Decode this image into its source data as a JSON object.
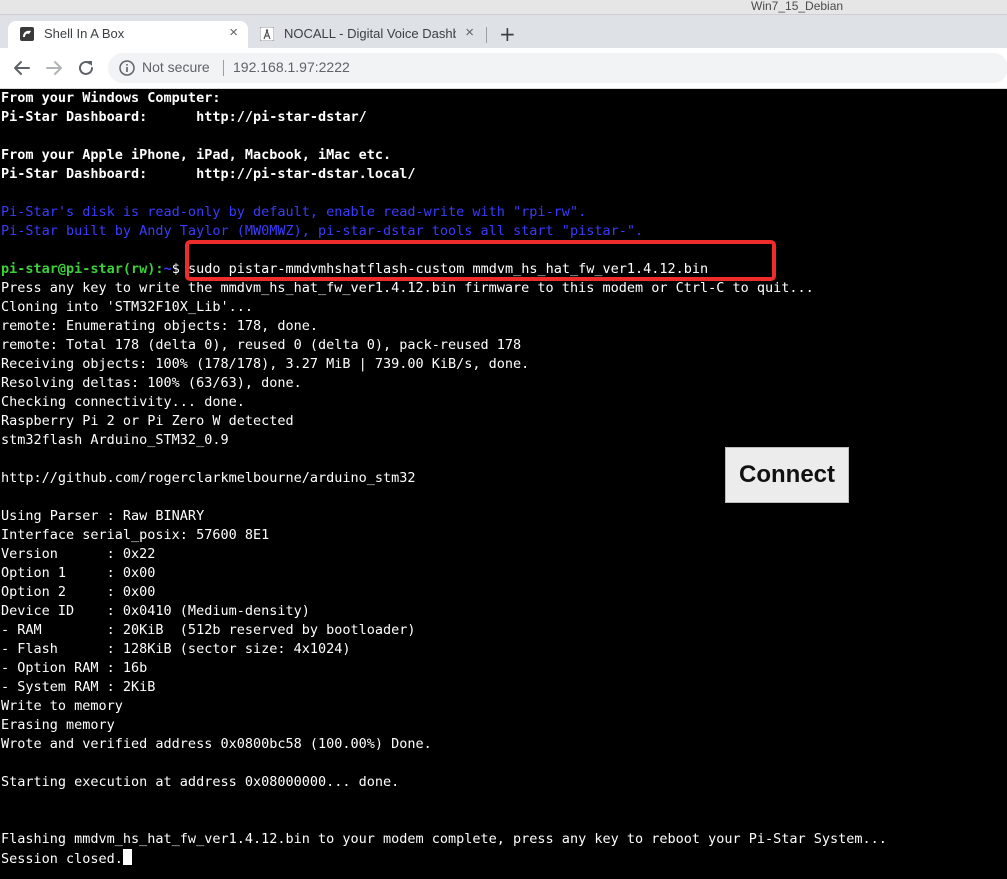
{
  "os": {
    "window_title": "Win7_15_Debian"
  },
  "browser": {
    "tabs": [
      {
        "title": "Shell In A Box",
        "favicon": "shell-icon",
        "active": true
      },
      {
        "title": "NOCALL - Digital Voice Dashb",
        "favicon": "radio-tower-icon",
        "active": false
      }
    ],
    "new_tab_label": "+",
    "close_label": "×",
    "security_label": "Not secure",
    "url": "192.168.1.97:2222"
  },
  "terminal": {
    "lines": [
      {
        "text": "From your Windows Computer:",
        "style": "bold"
      },
      {
        "text": "Pi-Star Dashboard:      http://pi-star-dstar/",
        "style": "bold"
      },
      {
        "text": "",
        "style": ""
      },
      {
        "text": "From your Apple iPhone, iPad, Macbook, iMac etc.",
        "style": "bold"
      },
      {
        "text": "Pi-Star Dashboard:      http://pi-star-dstar.local/",
        "style": "bold"
      },
      {
        "text": "",
        "style": ""
      },
      {
        "text": "Pi-Star's disk is read-only by default, enable read-write with \"rpi-rw\".",
        "style": "blue"
      },
      {
        "text": "Pi-Star built by Andy Taylor (MW0MWZ), pi-star-dstar tools all start \"pistar-\".",
        "style": "blue"
      },
      {
        "text": "",
        "style": ""
      },
      {
        "text": "",
        "style": "prompt"
      },
      {
        "text": "Press any key to write the mmdvm_hs_hat_fw_ver1.4.12.bin firmware to this modem or Ctrl-C to quit...",
        "style": ""
      },
      {
        "text": "Cloning into 'STM32F10X_Lib'...",
        "style": ""
      },
      {
        "text": "remote: Enumerating objects: 178, done.",
        "style": ""
      },
      {
        "text": "remote: Total 178 (delta 0), reused 0 (delta 0), pack-reused 178",
        "style": ""
      },
      {
        "text": "Receiving objects: 100% (178/178), 3.27 MiB | 739.00 KiB/s, done.",
        "style": ""
      },
      {
        "text": "Resolving deltas: 100% (63/63), done.",
        "style": ""
      },
      {
        "text": "Checking connectivity... done.",
        "style": ""
      },
      {
        "text": "Raspberry Pi 2 or Pi Zero W detected",
        "style": ""
      },
      {
        "text": "stm32flash Arduino_STM32_0.9",
        "style": ""
      },
      {
        "text": "",
        "style": ""
      },
      {
        "text": "http://github.com/rogerclarkmelbourne/arduino_stm32",
        "style": ""
      },
      {
        "text": "",
        "style": ""
      },
      {
        "text": "Using Parser : Raw BINARY",
        "style": ""
      },
      {
        "text": "Interface serial_posix: 57600 8E1",
        "style": ""
      },
      {
        "text": "Version      : 0x22",
        "style": ""
      },
      {
        "text": "Option 1     : 0x00",
        "style": ""
      },
      {
        "text": "Option 2     : 0x00",
        "style": ""
      },
      {
        "text": "Device ID    : 0x0410 (Medium-density)",
        "style": ""
      },
      {
        "text": "- RAM        : 20KiB  (512b reserved by bootloader)",
        "style": ""
      },
      {
        "text": "- Flash      : 128KiB (sector size: 4x1024)",
        "style": ""
      },
      {
        "text": "- Option RAM : 16b",
        "style": ""
      },
      {
        "text": "- System RAM : 2KiB",
        "style": ""
      },
      {
        "text": "Write to memory",
        "style": ""
      },
      {
        "text": "Erasing memory",
        "style": ""
      },
      {
        "text": "Wrote and verified address 0x0800bc58 (100.00%) Done.",
        "style": ""
      },
      {
        "text": "",
        "style": ""
      },
      {
        "text": "Starting execution at address 0x08000000... done.",
        "style": ""
      },
      {
        "text": "",
        "style": ""
      },
      {
        "text": "",
        "style": ""
      },
      {
        "text": "Flashing mmdvm_hs_hat_fw_ver1.4.12.bin to your modem complete, press any key to reboot your Pi-Star System...",
        "style": ""
      },
      {
        "text": "Session closed.",
        "style": "cursor"
      }
    ],
    "prompt": {
      "user_host": "pi-star@pi-star(rw):",
      "path": "~",
      "symbol": "$",
      "command": "sudo pistar-mmdvmhshatflash-custom mmdvm_hs_hat_fw_ver1.4.12.bin"
    }
  },
  "connect_button": {
    "label": "Connect"
  },
  "colors": {
    "terminal_bg": "#000000",
    "terminal_fg": "#ffffff",
    "info_blue": "#3b3bff",
    "prompt_green": "#3bd13b",
    "highlight_red": "#ef2c2c"
  }
}
